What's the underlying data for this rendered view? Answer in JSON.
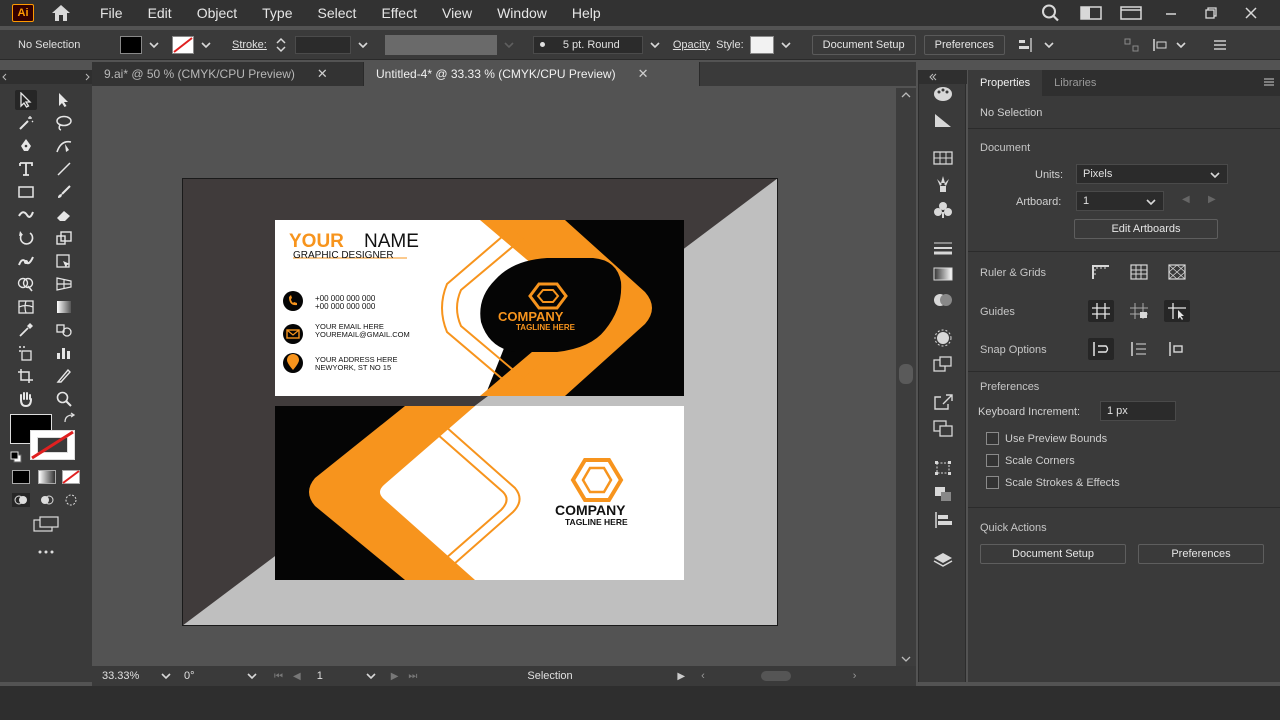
{
  "app": {
    "logo": "Ai",
    "menus": [
      "File",
      "Edit",
      "Object",
      "Type",
      "Select",
      "Effect",
      "View",
      "Window",
      "Help"
    ]
  },
  "control_bar": {
    "selection": "No Selection",
    "stroke_label": "Stroke:",
    "brush": "5 pt. Round",
    "opacity_label": "Opacity",
    "style_label": "Style:",
    "document_setup": "Document Setup",
    "preferences": "Preferences"
  },
  "tabs": [
    {
      "label": "9.ai* @ 50 % (CMYK/CPU Preview)",
      "active": false
    },
    {
      "label": "Untitled-4* @ 33.33 % (CMYK/CPU Preview)",
      "active": true
    }
  ],
  "status_bar": {
    "zoom": "33.33%",
    "rotation": "0°",
    "artboard": "1",
    "tool": "Selection"
  },
  "card": {
    "name_first": "YOUR",
    "name_last": "NAME",
    "role": "GRAPHIC DESIGNER",
    "phone1": "+00 000 000 000",
    "phone2": "+00 000 000 000",
    "email1": "YOUR EMAIL HERE",
    "email2": "YOUREMAIL@GMAIL.COM",
    "address1": "YOUR ADDRESS HERE",
    "address2": "NEWYORK, ST NO 15",
    "company": "COMPANY",
    "tagline": "TAGLINE HERE",
    "colors": {
      "orange": "#f7941d",
      "black": "#050505",
      "white": "#ffffff"
    }
  },
  "panel": {
    "tabs": [
      "Properties",
      "Libraries"
    ],
    "selection": "No Selection",
    "document_title": "Document",
    "units_label": "Units:",
    "units_value": "Pixels",
    "artboard_label": "Artboard:",
    "artboard_value": "1",
    "edit_artboards": "Edit Artboards",
    "ruler_grids": "Ruler & Grids",
    "guides": "Guides",
    "snap_options": "Snap Options",
    "preferences_title": "Preferences",
    "keyboard_increment_label": "Keyboard Increment:",
    "keyboard_increment_value": "1 px",
    "use_preview_bounds": "Use Preview Bounds",
    "scale_corners": "Scale Corners",
    "scale_strokes": "Scale Strokes & Effects",
    "quick_actions": "Quick Actions",
    "document_setup": "Document Setup",
    "preferences": "Preferences"
  }
}
